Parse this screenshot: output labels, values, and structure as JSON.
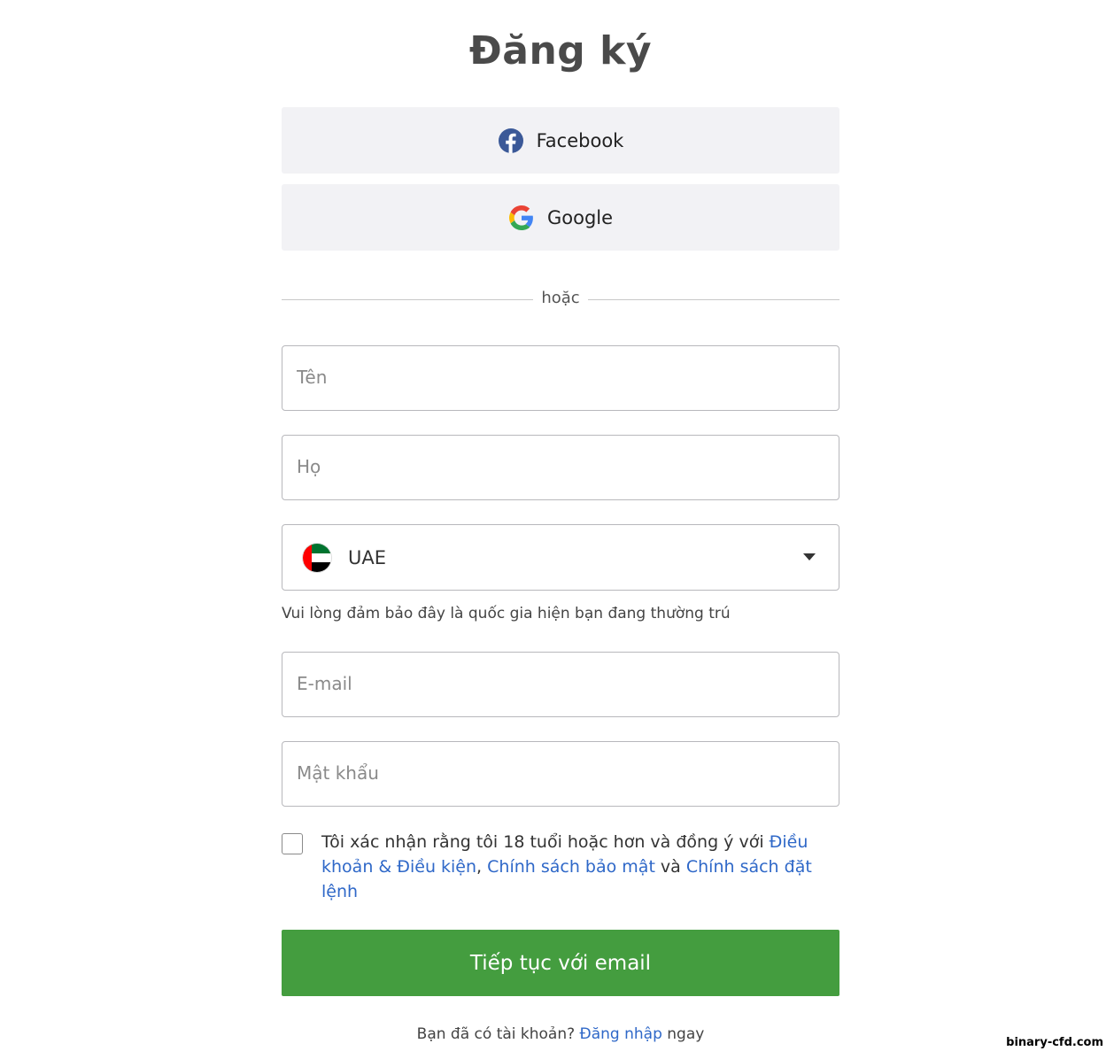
{
  "page": {
    "title": "Đăng ký"
  },
  "social": {
    "facebook_label": "Facebook",
    "google_label": "Google"
  },
  "divider": {
    "text": "hoặc"
  },
  "form": {
    "first_name_placeholder": "Tên",
    "last_name_placeholder": "Họ",
    "country": {
      "selected": "UAE",
      "flag_icon": "uae-flag-icon"
    },
    "country_hint": "Vui lòng đảm bảo đây là quốc gia hiện bạn đang thường trú",
    "email_placeholder": "E-mail",
    "password_placeholder": "Mật khẩu",
    "consent": {
      "checked": false,
      "text_before": "Tôi xác nhận rằng tôi 18 tuổi hoặc hơn và đồng ý với ",
      "link_terms": "Điều khoản & Điều kiện",
      "sep1": ", ",
      "link_privacy": "Chính sách bảo mật",
      "sep2": " và ",
      "link_order": "Chính sách đặt lệnh"
    },
    "submit_label": "Tiếp tục với email"
  },
  "footer": {
    "text_before": "Bạn đã có tài khoản? ",
    "login_link": "Đăng nhập",
    "text_after": " ngay"
  },
  "watermark": "binary-cfd.com",
  "colors": {
    "primary_button": "#449d3f",
    "link": "#2f68c8",
    "social_bg": "#f2f2f5",
    "facebook": "#3b5998"
  }
}
